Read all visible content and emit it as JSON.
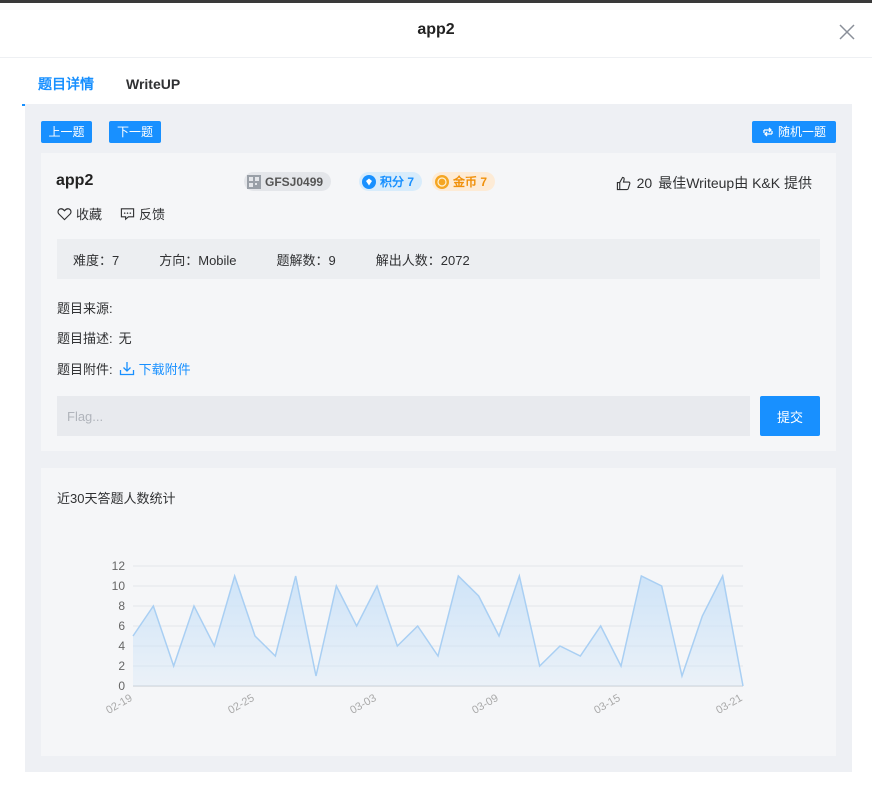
{
  "modal": {
    "title": "app2"
  },
  "tabs": [
    {
      "label": "题目详情",
      "active": true
    },
    {
      "label": "WriteUP",
      "active": false
    }
  ],
  "nav": {
    "prev_label": "上一题",
    "next_label": "下一题",
    "random_label": "随机一题"
  },
  "challenge": {
    "name": "app2",
    "id_tag": "GFSJ0499",
    "score_tag": "积分 7",
    "gold_tag": "金币 7",
    "likes": "20",
    "best_writeup": "最佳Writeup由 K&K 提供",
    "favorite_label": "收藏",
    "feedback_label": "反馈",
    "stats": {
      "difficulty": "难度：7",
      "direction": "方向：Mobile",
      "solve_count": "题解数：9",
      "solvers": "解出人数：2072"
    },
    "source_label": "题目来源:",
    "desc_label": "题目描述:",
    "desc_value": "无",
    "attach_label": "题目附件:",
    "download_label": "下载附件",
    "flag_placeholder": "Flag...",
    "submit_label": "提交"
  },
  "colors": {
    "accent": "#1890ff",
    "gold": "#f0900a",
    "area": "#cde3f8",
    "line": "#a9cff3"
  },
  "chart_data": {
    "type": "area",
    "title": "近30天答题人数统计",
    "x": [
      "02-19",
      "02-20",
      "02-21",
      "02-22",
      "02-23",
      "02-24",
      "02-25",
      "02-26",
      "02-27",
      "02-28",
      "03-01",
      "03-02",
      "03-03",
      "03-04",
      "03-05",
      "03-06",
      "03-07",
      "03-08",
      "03-09",
      "03-10",
      "03-11",
      "03-12",
      "03-13",
      "03-14",
      "03-15",
      "03-16",
      "03-17",
      "03-18",
      "03-19",
      "03-20",
      "03-21"
    ],
    "x_tick_labels": [
      "02-19",
      "02-25",
      "03-03",
      "03-09",
      "03-15",
      "03-21"
    ],
    "values": [
      5,
      8,
      2,
      8,
      4,
      11,
      5,
      3,
      11,
      1,
      10,
      6,
      10,
      4,
      6,
      3,
      11,
      9,
      5,
      11,
      2,
      4,
      3,
      6,
      2,
      11,
      10,
      1,
      7,
      11,
      0
    ],
    "ylim": [
      0,
      12
    ],
    "yticks": [
      0,
      2,
      4,
      6,
      8,
      10,
      12
    ],
    "grid": true
  }
}
